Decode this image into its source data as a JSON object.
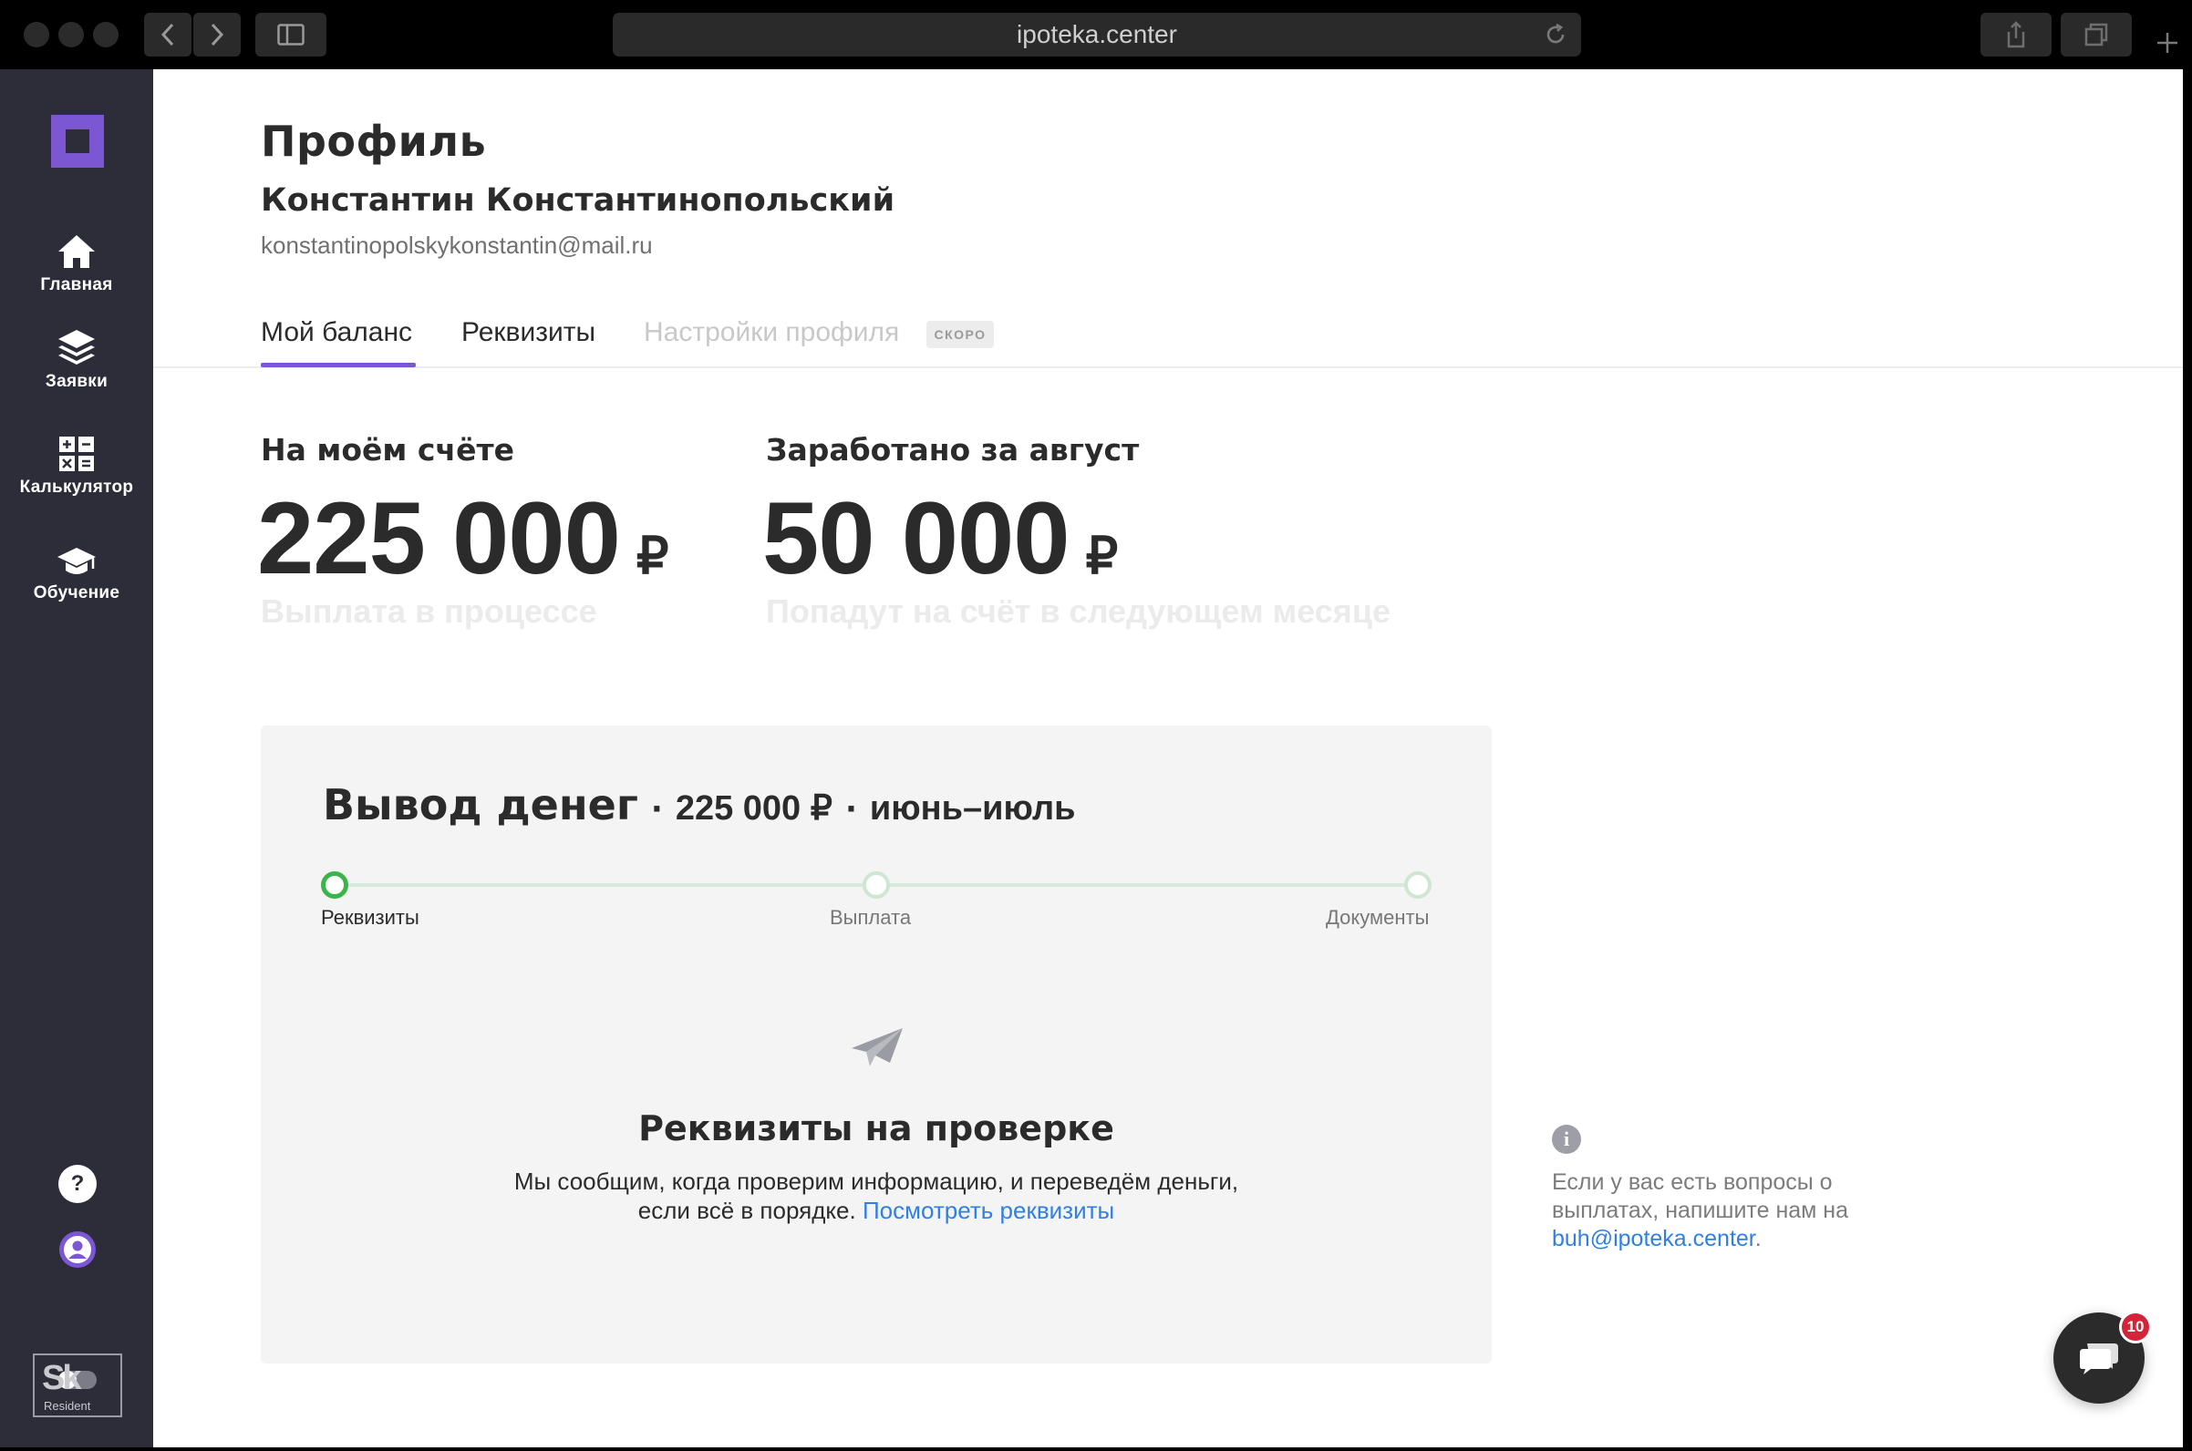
{
  "browser": {
    "url": "ipoteka.center"
  },
  "sidebar": {
    "items": [
      {
        "label": "Главная",
        "icon": "home-icon"
      },
      {
        "label": "Заявки",
        "icon": "layers-icon"
      },
      {
        "label": "Калькулятор",
        "icon": "calculator-icon"
      },
      {
        "label": "Обучение",
        "icon": "graduation-cap-icon"
      }
    ],
    "help_label": "?",
    "badge_logo": "Sk",
    "badge_caption": "Resident"
  },
  "profile": {
    "title": "Профиль",
    "name": "Константин Константинопольский",
    "email": "konstantinopolskykonstantin@mail.ru"
  },
  "tabs": [
    {
      "label": "Мой баланс",
      "active": true
    },
    {
      "label": "Реквизиты",
      "active": false
    },
    {
      "label": "Настройки профиля",
      "disabled": true,
      "badge": "СКОРО"
    }
  ],
  "balance": {
    "account_label": "На моём счёте",
    "account_value": "225 000",
    "account_currency": "₽",
    "account_sub": "Выплата в процессе",
    "earned_label": "Заработано за август",
    "earned_value": "50 000",
    "earned_currency": "₽",
    "earned_sub": "Попадут на счёт в следующем месяце"
  },
  "withdrawal": {
    "title": "Вывод денег",
    "separator": "·",
    "amount": "225 000 ₽",
    "period": "июнь–июль",
    "steps": [
      {
        "label": "Реквизиты",
        "state": "active"
      },
      {
        "label": "Выплата",
        "state": "pending"
      },
      {
        "label": "Документы",
        "state": "pending"
      }
    ],
    "status_title": "Реквизиты на проверке",
    "status_text": "Мы сообщим, когда проверим информацию, и переведём деньги, если всё в порядке.",
    "status_link": "Посмотреть реквизиты"
  },
  "info": {
    "icon_label": "i",
    "text": "Если у вас есть вопросы о выплатах, напишите нам на",
    "email": "buh@ipoteka.center",
    "suffix": "."
  },
  "chat": {
    "unread_count": "10"
  },
  "colors": {
    "accent": "#7b57d4",
    "sidebar_bg": "#2d2d3a",
    "success": "#3bb54a",
    "link": "#2f7fe5",
    "badge_red": "#d32438"
  }
}
